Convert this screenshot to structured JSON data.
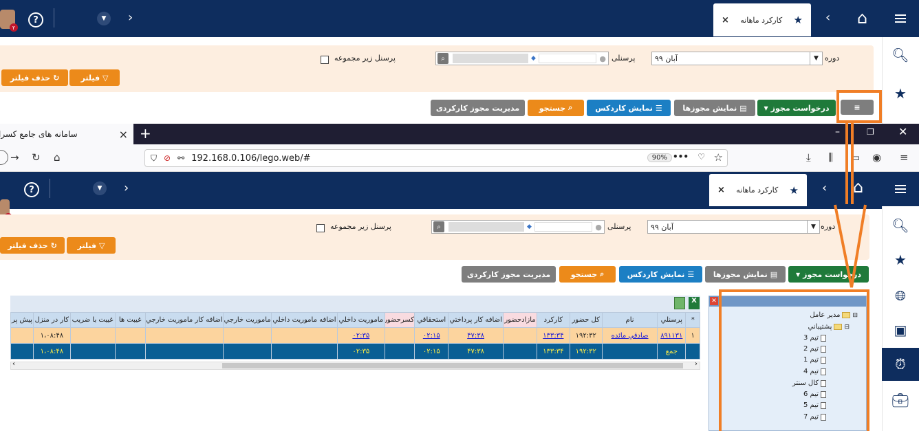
{
  "top": {
    "tab_title": "کارکرد ماهانه",
    "badge": "۲",
    "filter": {
      "period_label": "دوره",
      "period_value": "آبان ۹۹",
      "personnel_label": "پرسنلی",
      "sub_personnel_label": "پرسنل زیر مجموعه",
      "filter_btn": "فیلتر",
      "clear_filter_btn": "حذف فیلتر"
    },
    "actions": {
      "request": "درخواست مجوز",
      "show_permits": "نمایش مجوزها",
      "show_cardex": "نمایش کاردکس",
      "search": "جستجو",
      "manage_work": "مدیریت مجوز کارکردی"
    }
  },
  "browser": {
    "tab_title": "سامانه های جامع کسرا",
    "url": "192.168.0.106/lego.web/#",
    "zoom": "90%"
  },
  "bottom": {
    "tab_title": "کارکرد ماهانه",
    "badge": "۲",
    "filter": {
      "period_label": "دوره",
      "period_value": "آبان ۹۹",
      "personnel_label": "پرسنلی",
      "sub_personnel_label": "پرسنل زیر مجموعه",
      "filter_btn": "فیلتر",
      "clear_filter_btn": "حذف فیلتر"
    },
    "actions": {
      "request": "درخواست مجوز",
      "show_permits": "نمایش مجوزها",
      "show_cardex": "نمایش کاردکس",
      "search": "جستجو",
      "manage_work": "مدیریت مجوز کارکردی"
    }
  },
  "grid": {
    "columns": [
      "*",
      "پرسنلي",
      "نام",
      "کل حضور",
      "کارکرد",
      "مازادحضور",
      "اضافه کار پرداختي",
      "استحقاقي",
      "کسرحضور",
      "ماموريت داخلي",
      "اضافه ماموريت داخلي",
      "ماموريت خارجي",
      "اضافه کار ماموريت خارجي",
      "غيبت ها",
      "غيبت با ضريب",
      "کار در منزل",
      "پيش پر"
    ],
    "row": {
      "index": "۱",
      "personnel": "۸۹۱۱۳۱",
      "name": "صادقي مائده",
      "total_presence": "۱۹۲:۳۲",
      "work": "۱۳۳:۳۴",
      "overtime_paid": "۴۷:۳۸",
      "entitled": "۰۲:۱۵",
      "mission_internal": "۰۲:۳۵",
      "home_work": "۱،۰۸:۴۸"
    },
    "total": {
      "personnel": "جمع",
      "total_presence": "۱۹۲:۳۲",
      "work": "۱۳۳:۳۴",
      "overtime_paid": "۴۷:۳۸",
      "entitled": "۰۲:۱۵",
      "mission_internal": "۰۲:۳۵",
      "home_work": "۱،۰۸:۴۸"
    }
  },
  "tree": {
    "root": "مدير عامل",
    "child": "پشتيباني",
    "items": [
      "تیم 3",
      "تیم 2",
      "تیم 1",
      "تیم 4",
      "کال سنتر",
      "تیم 6",
      "تیم 5",
      "تیم 7"
    ]
  },
  "colors": {
    "navy": "#0e2d5e",
    "orange": "#ec8a1a",
    "annotation": "#f07e26"
  }
}
